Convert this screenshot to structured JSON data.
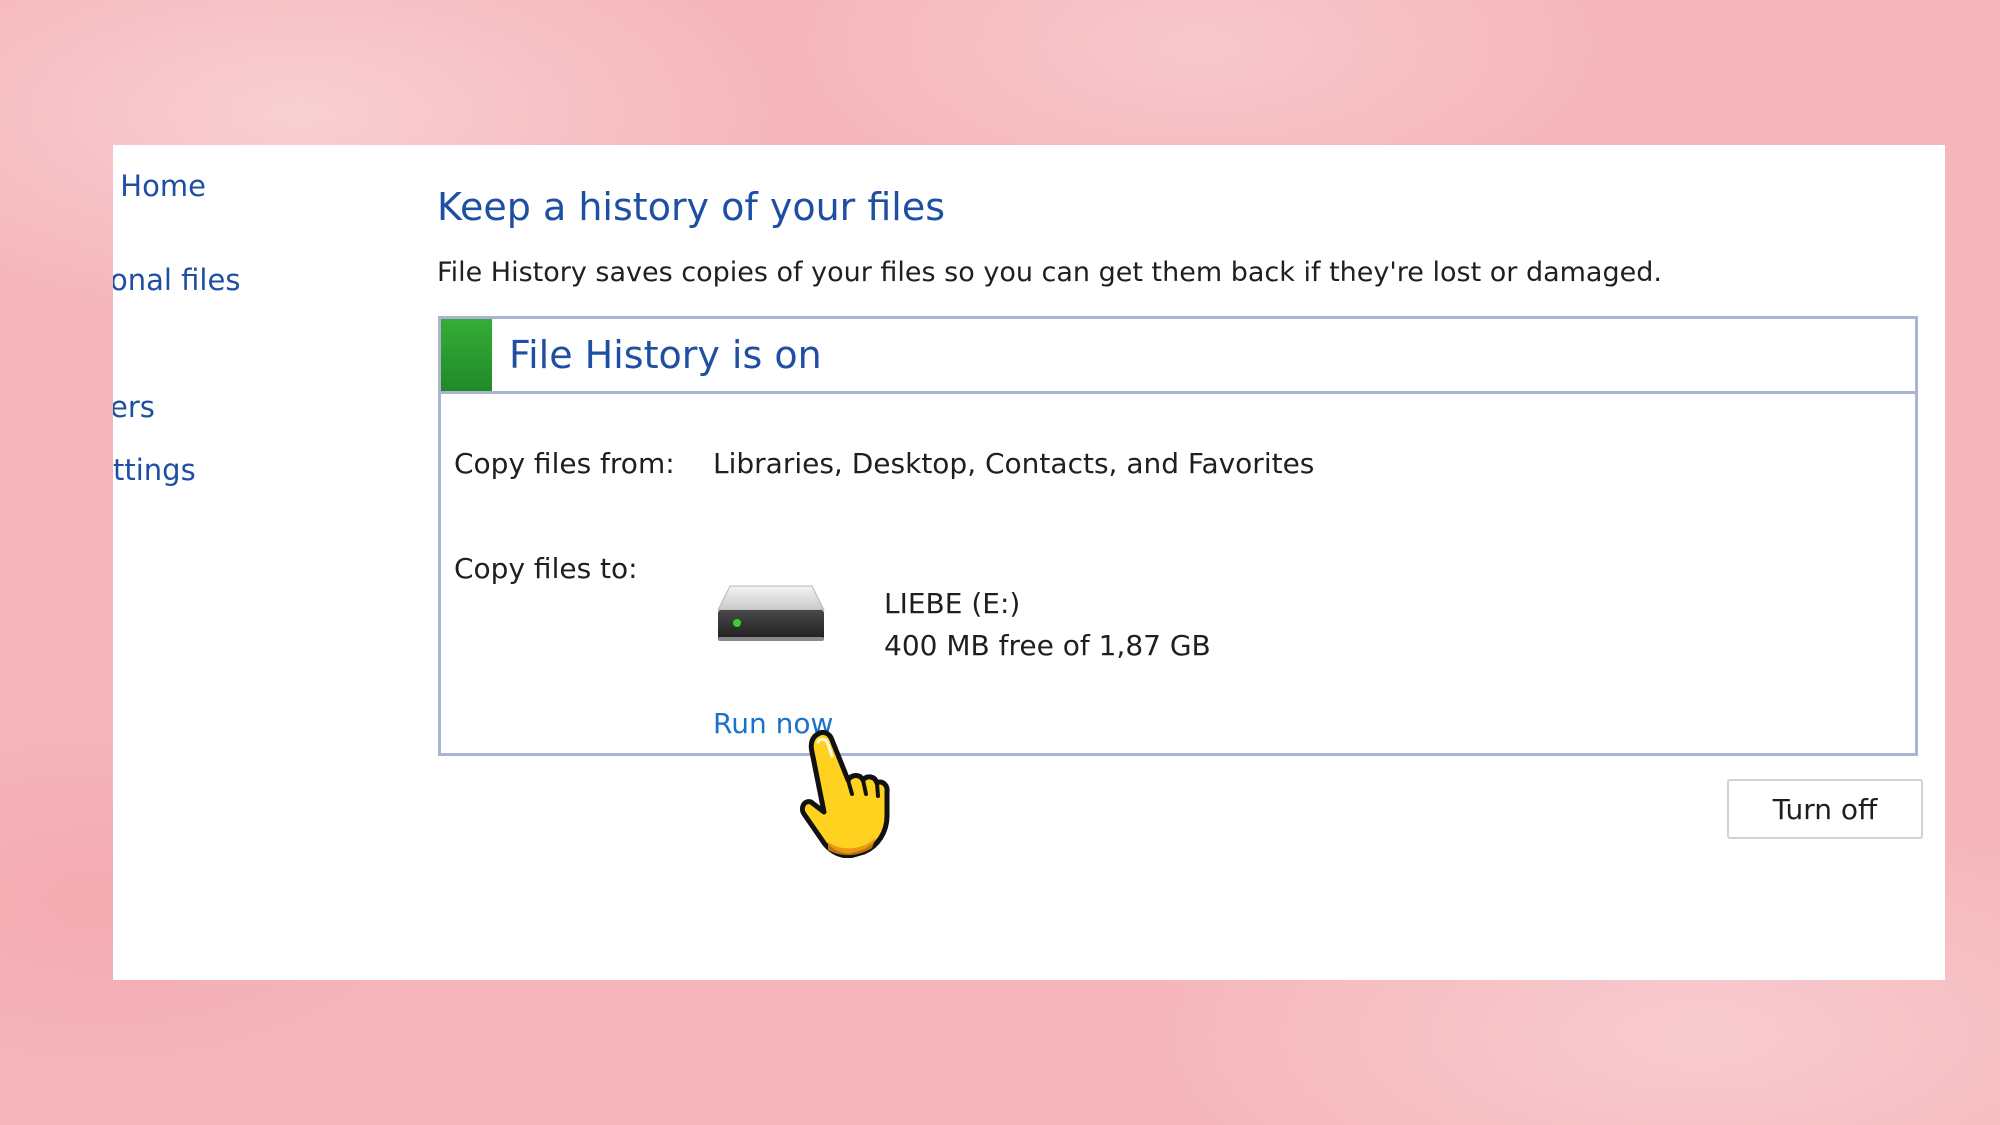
{
  "sidebar": {
    "items": [
      {
        "label": "l Home"
      },
      {
        "label": "onal files"
      },
      {
        "label": "ers"
      },
      {
        "label": "ttings"
      }
    ]
  },
  "main": {
    "title": "Keep a history of your files",
    "description": "File History saves copies of your files so you can get them back if they're lost or damaged."
  },
  "status_panel": {
    "status_text": "File History is on",
    "status_color": "#2fa033",
    "copy_from_label": "Copy files from:",
    "copy_from_value": "Libraries, Desktop, Contacts, and Favorites",
    "copy_to_label": "Copy files to:",
    "drive_icon": "hard-drive-icon",
    "drive_name": "LIEBE (E:)",
    "drive_space": "400 MB free of 1,87 GB",
    "run_now_label": "Run now"
  },
  "actions": {
    "turn_off_label": "Turn off"
  },
  "overlay": {
    "cursor_icon": "pointing-hand-cursor-icon"
  }
}
